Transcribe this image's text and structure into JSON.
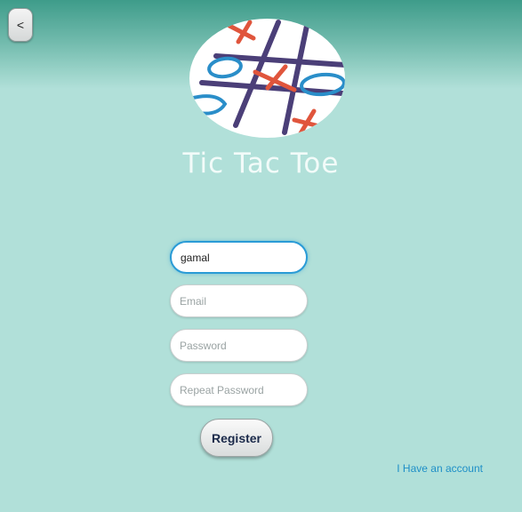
{
  "header": {
    "back_label": "<"
  },
  "logo": {
    "title": "Tic Tac Toe"
  },
  "form": {
    "username_value": "gamal",
    "email_placeholder": "Email",
    "password_placeholder": "Password",
    "repeat_password_placeholder": "Repeat Password",
    "register_label": "Register",
    "account_link": "I Have an account"
  },
  "colors": {
    "background": "#b1e0d9",
    "header_gradient": "#3e9c8a",
    "focus_border": "#2a9bd6",
    "link": "#1e8fc7",
    "x_mark": "#e0553c",
    "o_mark": "#2a8ec9",
    "grid": "#4b3f78"
  }
}
